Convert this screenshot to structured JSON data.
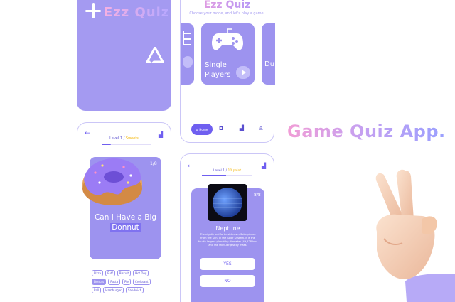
{
  "splash": {
    "logo_text": "Ezz Quiz"
  },
  "home": {
    "title": "Ezz Quiz",
    "subtitle": "Choose your mode, and let's play a game!",
    "card_label": "Single Players",
    "next_card_label": "Du",
    "nav": {
      "home_label": "Home"
    }
  },
  "donut_quiz": {
    "level_prefix": "Level 1 /",
    "level_topic": "Sweets",
    "counter": "1/8",
    "question_pre": "Can I Have a Big",
    "question_answer": "Donnut",
    "progress": 0.18,
    "chips": [
      "Pizza",
      "Puff",
      "Biscuit",
      "Hot Dog",
      "Donuts",
      "Pasta",
      "Pie",
      "Croissant",
      "Roll",
      "Hamburger",
      "Sandwich"
    ],
    "selected_chip": "Donuts"
  },
  "planet_quiz": {
    "level_prefix": "Level 1 /",
    "level_topic": "10 point",
    "counter": "8/8",
    "name": "Neptune",
    "description": "The eighth and farthest-known Solar planet from the Sun. In the Solar System, it is the fourth-largest planet by diameter (49,528 km) and the third-largest by mass.",
    "progress": 0.48,
    "yes_label": "YES",
    "no_label": "NO"
  },
  "headline": "Game Quiz App.",
  "colors": {
    "accent": "#9d93ef",
    "primary": "#6f5ff0",
    "highlight": "#f3b400"
  }
}
